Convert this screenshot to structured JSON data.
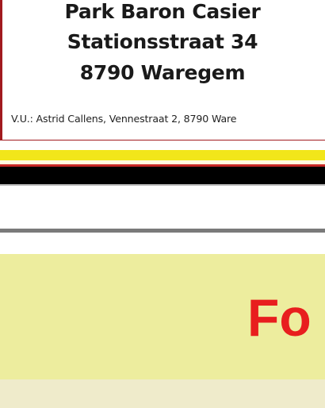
{
  "poster": {
    "line1": "Park Baron Casier",
    "line2": "Stationsstraat 34",
    "line3": "8790 Waregem",
    "publisher": "V.U.: Astrid Callens, Vennestraat 2, 8790 Ware"
  },
  "banner": {
    "title": "Fo"
  },
  "colors": {
    "banner_bg": "#eded9e",
    "title_red": "#e81e1e",
    "stripe_yellow": "#f2e61a",
    "stripe_black": "#000000",
    "border_red": "#a11a1f"
  }
}
